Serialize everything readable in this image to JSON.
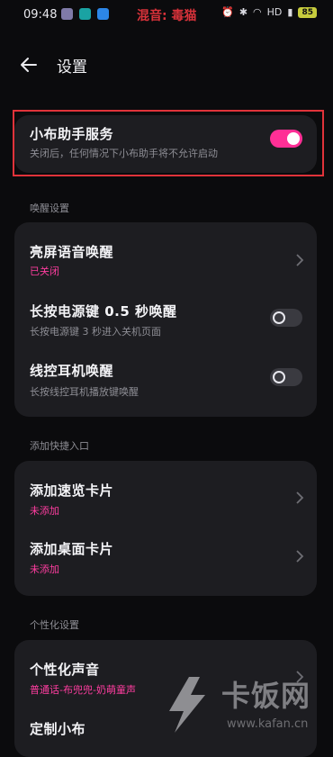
{
  "status": {
    "time": "09:48",
    "watermark": "混音: 毒猫",
    "battery": "85",
    "network": "HD"
  },
  "header": {
    "title": "设置"
  },
  "assistant": {
    "title": "小布助手服务",
    "subtitle": "关闭后，任何情况下小布助手将不允许启动",
    "enabled": true
  },
  "wake": {
    "section_label": "唤醒设置",
    "items": [
      {
        "title": "亮屏语音唤醒",
        "subtitle": "已关闭"
      },
      {
        "title": "长按电源键 0.5 秒唤醒",
        "subtitle": "长按电源键 3 秒进入关机页面",
        "enabled": false
      },
      {
        "title": "线控耳机唤醒",
        "subtitle": "长按线控耳机播放键唤醒",
        "enabled": false
      }
    ]
  },
  "shortcuts": {
    "section_label": "添加快捷入口",
    "items": [
      {
        "title": "添加速览卡片",
        "subtitle": "未添加"
      },
      {
        "title": "添加桌面卡片",
        "subtitle": "未添加"
      }
    ]
  },
  "personalize": {
    "section_label": "个性化设置",
    "items": [
      {
        "title": "个性化声音",
        "subtitle": "普通话-布兜兜-奶萌童声"
      },
      {
        "title": "定制小布"
      }
    ]
  },
  "watermark": {
    "brand": "卡饭网",
    "url": "www.kafan.cn"
  },
  "colors": {
    "accent": "#ff2f96",
    "highlight": "#e0333a",
    "card": "#1d1d21"
  }
}
